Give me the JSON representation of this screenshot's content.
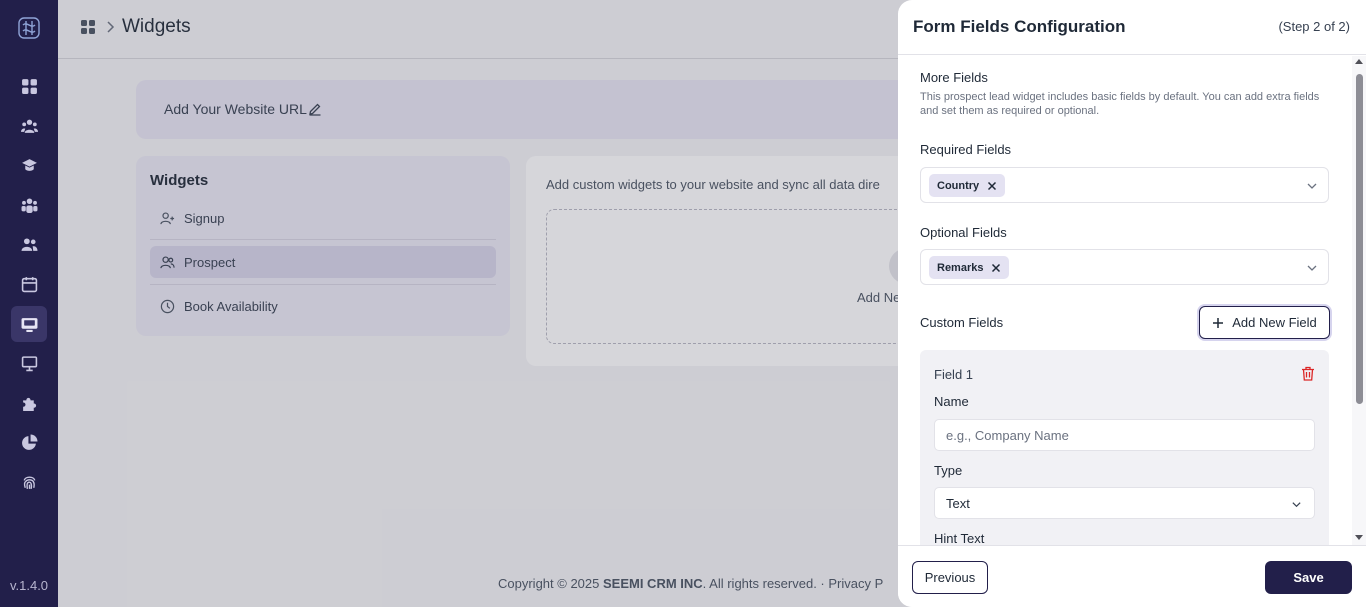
{
  "sidebar": {
    "version": "v.1.4.0",
    "items": [
      {
        "icon": "dashboard-icon"
      },
      {
        "icon": "users-group-icon"
      },
      {
        "icon": "graduation-cap-icon"
      },
      {
        "icon": "team-icon"
      },
      {
        "icon": "contacts-icon"
      },
      {
        "icon": "calendar-icon"
      },
      {
        "icon": "widgets-icon",
        "active": true
      },
      {
        "icon": "monitor-icon"
      },
      {
        "icon": "puzzle-icon"
      },
      {
        "icon": "pie-chart-icon"
      },
      {
        "icon": "fingerprint-icon"
      }
    ]
  },
  "header": {
    "title": "Widgets"
  },
  "url_card": {
    "label": "Add Your Website URL"
  },
  "widgets_panel": {
    "title": "Widgets",
    "items": [
      {
        "label": "Signup",
        "icon": "user-plus-icon"
      },
      {
        "label": "Prospect",
        "icon": "users-icon",
        "active": true
      },
      {
        "label": "Book Availability",
        "icon": "clock-icon"
      }
    ]
  },
  "description": {
    "text": "Add custom widgets to your website and sync all data dire",
    "add_label": "Add Ne"
  },
  "footer": {
    "copyright_prefix": "Copyright © 2025 ",
    "company": "SEEMI CRM INC",
    "copyright_suffix": ". All rights reserved. · Privacy P"
  },
  "drawer": {
    "title": "Form Fields Configuration",
    "step": "(Step 2 of 2)",
    "more_fields": {
      "title": "More Fields",
      "description": "This prospect lead widget includes basic fields by default. You can add extra fields and set them as required or optional."
    },
    "required_fields": {
      "label": "Required Fields",
      "chip": "Country"
    },
    "optional_fields": {
      "label": "Optional Fields",
      "chip": "Remarks"
    },
    "custom_fields": {
      "label": "Custom Fields",
      "add_button": "Add New Field"
    },
    "field_1": {
      "title": "Field 1",
      "name_label": "Name",
      "name_placeholder": "e.g., Company Name",
      "type_label": "Type",
      "type_value": "Text",
      "hint_label": "Hint Text"
    },
    "buttons": {
      "previous": "Previous",
      "save": "Save"
    }
  },
  "colors": {
    "sidebar_bg": "#221f4a",
    "accent": "#221f4a",
    "delete": "#dc2626"
  }
}
